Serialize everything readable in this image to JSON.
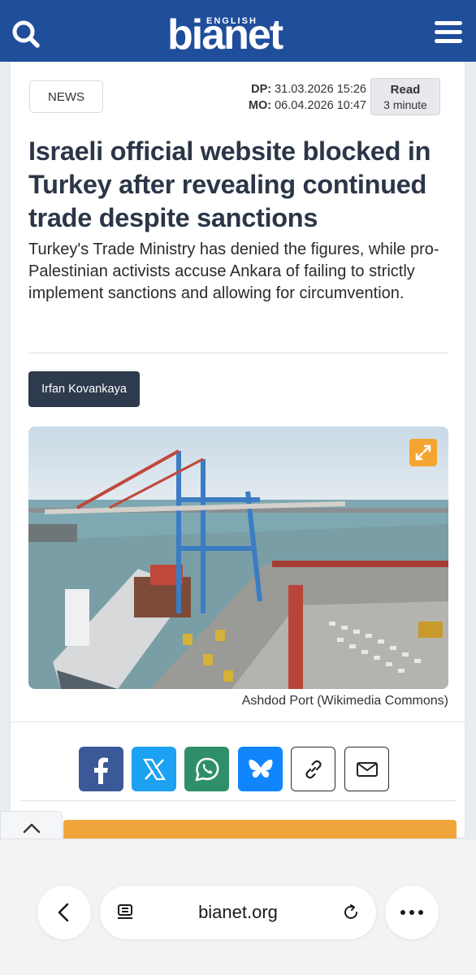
{
  "header": {
    "logo_small": "ENGLISH",
    "logo_main": "bianet",
    "brand_color": "#1f4e9b"
  },
  "article": {
    "category": "NEWS",
    "published_label": "DP:",
    "published": "31.03.2026 15:26",
    "modified_label": "MO:",
    "modified": "06.04.2026 10:47",
    "read_label": "Read",
    "read_time": "3 minute",
    "headline": "Israeli official website blocked in Turkey after revealing continued trade despite sanctions",
    "summary": "Turkey's Trade Ministry has denied the figures, while pro-Palestinian activists accuse Ankara of failing to strictly implement sanctions and allowing for circumvention.",
    "author": "Irfan Kovankaya",
    "image_caption": "Ashdod Port (Wikimedia Commons)"
  },
  "share": {
    "buttons": [
      {
        "name": "facebook",
        "color": "#3b5998"
      },
      {
        "name": "x",
        "color": "#1da1f2"
      },
      {
        "name": "whatsapp",
        "color": "#2f8f6b"
      },
      {
        "name": "bluesky",
        "color": "#1185fe"
      },
      {
        "name": "copy-link",
        "color": "#ffffff"
      },
      {
        "name": "email",
        "color": "#ffffff"
      }
    ]
  },
  "browser": {
    "url": "bianet.org"
  }
}
